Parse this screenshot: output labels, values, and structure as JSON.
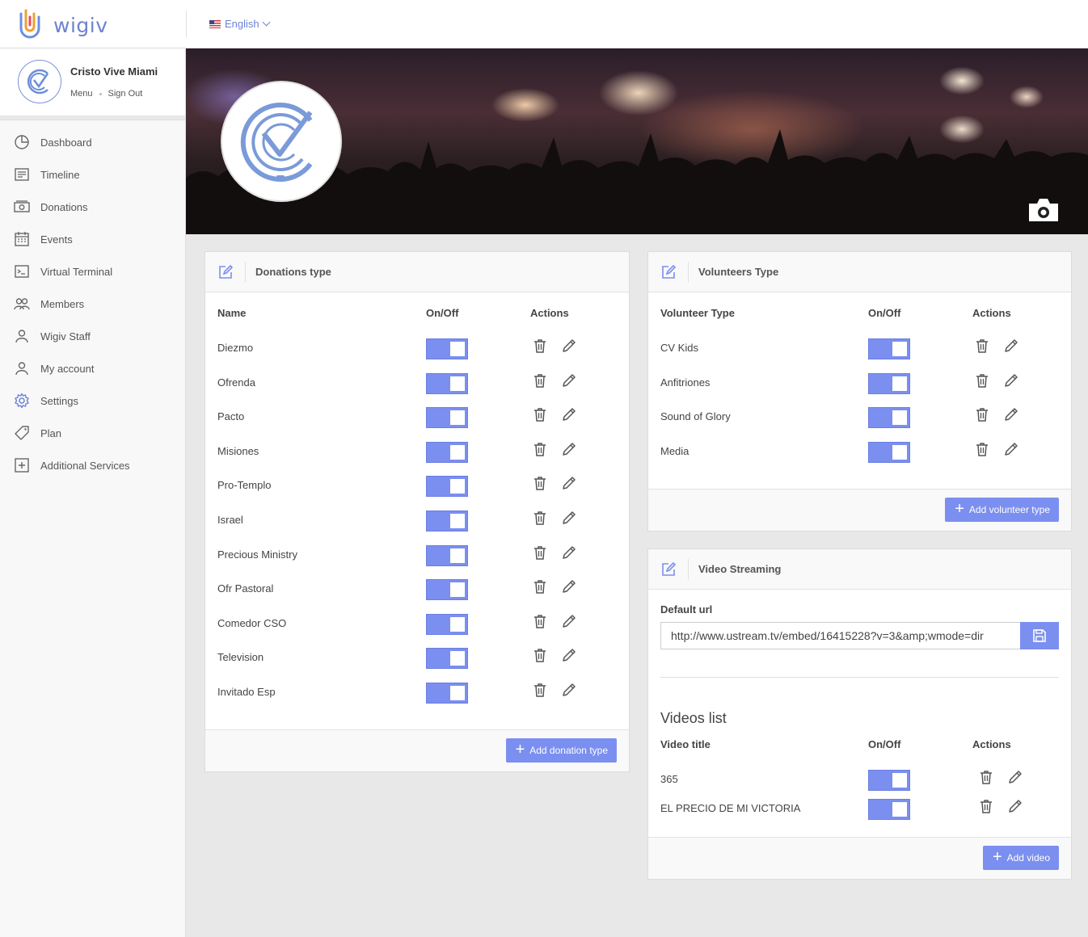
{
  "app": {
    "logo_text": "wigiv"
  },
  "header": {
    "language": "English"
  },
  "profile": {
    "org_name": "Cristo Vive Miami",
    "menu_link": "Menu",
    "signout_link": "Sign Out"
  },
  "sidebar": {
    "items": [
      {
        "label": "Dashboard",
        "icon": "dashboard-icon"
      },
      {
        "label": "Timeline",
        "icon": "timeline-icon"
      },
      {
        "label": "Donations",
        "icon": "donations-icon"
      },
      {
        "label": "Events",
        "icon": "calendar-icon"
      },
      {
        "label": "Virtual Terminal",
        "icon": "terminal-icon"
      },
      {
        "label": "Members",
        "icon": "members-icon"
      },
      {
        "label": "Wigiv Staff",
        "icon": "user-icon"
      },
      {
        "label": "My account",
        "icon": "user-icon"
      },
      {
        "label": "Settings",
        "icon": "gear-icon"
      },
      {
        "label": "Plan",
        "icon": "tag-icon"
      },
      {
        "label": "Additional Services",
        "icon": "plus-square-icon"
      }
    ],
    "active_index": 8
  },
  "donations": {
    "title": "Donations type",
    "col_name": "Name",
    "col_onoff": "On/Off",
    "col_actions": "Actions",
    "rows": [
      {
        "name": "Diezmo",
        "on": true
      },
      {
        "name": "Ofrenda",
        "on": true
      },
      {
        "name": "Pacto",
        "on": true
      },
      {
        "name": "Misiones",
        "on": true
      },
      {
        "name": "Pro-Templo",
        "on": true
      },
      {
        "name": "Israel",
        "on": true
      },
      {
        "name": "Precious Ministry",
        "on": true
      },
      {
        "name": "Ofr Pastoral",
        "on": true
      },
      {
        "name": "Comedor CSO",
        "on": true
      },
      {
        "name": "Television",
        "on": true
      },
      {
        "name": "Invitado Esp",
        "on": true
      }
    ],
    "add_label": "Add donation type"
  },
  "volunteers": {
    "title": "Volunteers Type",
    "col_name": "Volunteer Type",
    "col_onoff": "On/Off",
    "col_actions": "Actions",
    "rows": [
      {
        "name": "CV Kids",
        "on": true
      },
      {
        "name": "Anfitriones",
        "on": true
      },
      {
        "name": "Sound of Glory",
        "on": true
      },
      {
        "name": "Media",
        "on": true
      }
    ],
    "add_label": "Add volunteer type"
  },
  "streaming": {
    "title": "Video Streaming",
    "url_label": "Default url",
    "url_value": "http://www.ustream.tv/embed/16415228?v=3&amp;wmode=dir",
    "videos_title": "Videos list",
    "col_name": "Video title",
    "col_onoff": "On/Off",
    "col_actions": "Actions",
    "rows": [
      {
        "name": "365",
        "on": true
      },
      {
        "name": "EL PRECIO DE MI VICTORIA",
        "on": true
      }
    ],
    "add_label": "Add video"
  },
  "colors": {
    "accent": "#7b8ff0",
    "brand": "#6d84cf"
  }
}
